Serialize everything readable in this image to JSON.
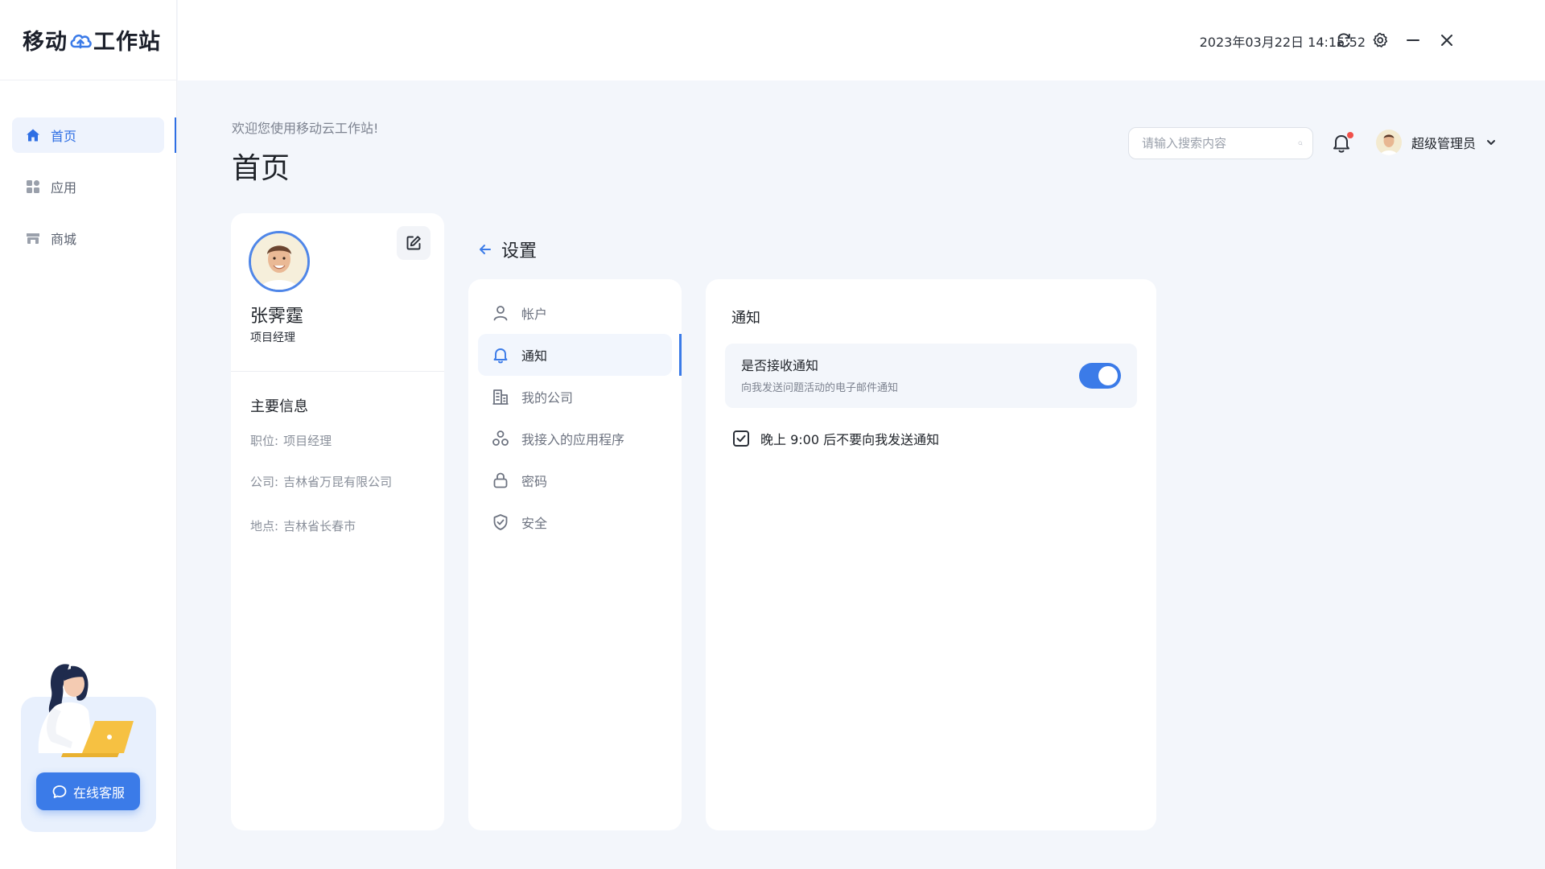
{
  "app": {
    "logo_left": "移动",
    "logo_right": "工作站"
  },
  "sidebar": {
    "items": [
      {
        "label": "首页",
        "icon": "home-icon",
        "active": true
      },
      {
        "label": "应用",
        "icon": "apps-icon",
        "active": false
      },
      {
        "label": "商城",
        "icon": "store-icon",
        "active": false
      }
    ],
    "support_label": "在线客服"
  },
  "topbar": {
    "datetime": "2023年03月22日 14:15:52",
    "controls": [
      "refresh-icon",
      "gear-icon",
      "minimize-icon",
      "close-icon"
    ]
  },
  "header": {
    "welcome": "欢迎您使用移动云工作站!",
    "title": "首页",
    "search_placeholder": "请输入搜索内容",
    "username": "超级管理员"
  },
  "profile": {
    "name": "张霁霆",
    "role": "项目经理",
    "info_title": "主要信息",
    "fields": [
      {
        "label": "职位:",
        "value": "项目经理"
      },
      {
        "label": "公司:",
        "value": "吉林省万昆有限公司"
      },
      {
        "label": "地点:",
        "value": "吉林省长春市"
      }
    ]
  },
  "settings": {
    "title": "设置",
    "menu": [
      {
        "label": "帐户",
        "icon": "user-icon",
        "active": false
      },
      {
        "label": "通知",
        "icon": "bell-icon",
        "active": true
      },
      {
        "label": "我的公司",
        "icon": "building-icon",
        "active": false
      },
      {
        "label": "我接入的应用程序",
        "icon": "apps-circles-icon",
        "active": false
      },
      {
        "label": "密码",
        "icon": "lock-icon",
        "active": false
      },
      {
        "label": "安全",
        "icon": "shield-icon",
        "active": false
      }
    ]
  },
  "notification": {
    "title": "通知",
    "receive_title": "是否接收通知",
    "receive_desc": "向我发送问题活动的电子邮件通知",
    "receive_enabled": true,
    "night_label": "晚上 9:00 后不要向我发送通知",
    "night_checked": true
  },
  "colors": {
    "accent": "#3b7be8",
    "badge": "#f0504a"
  }
}
